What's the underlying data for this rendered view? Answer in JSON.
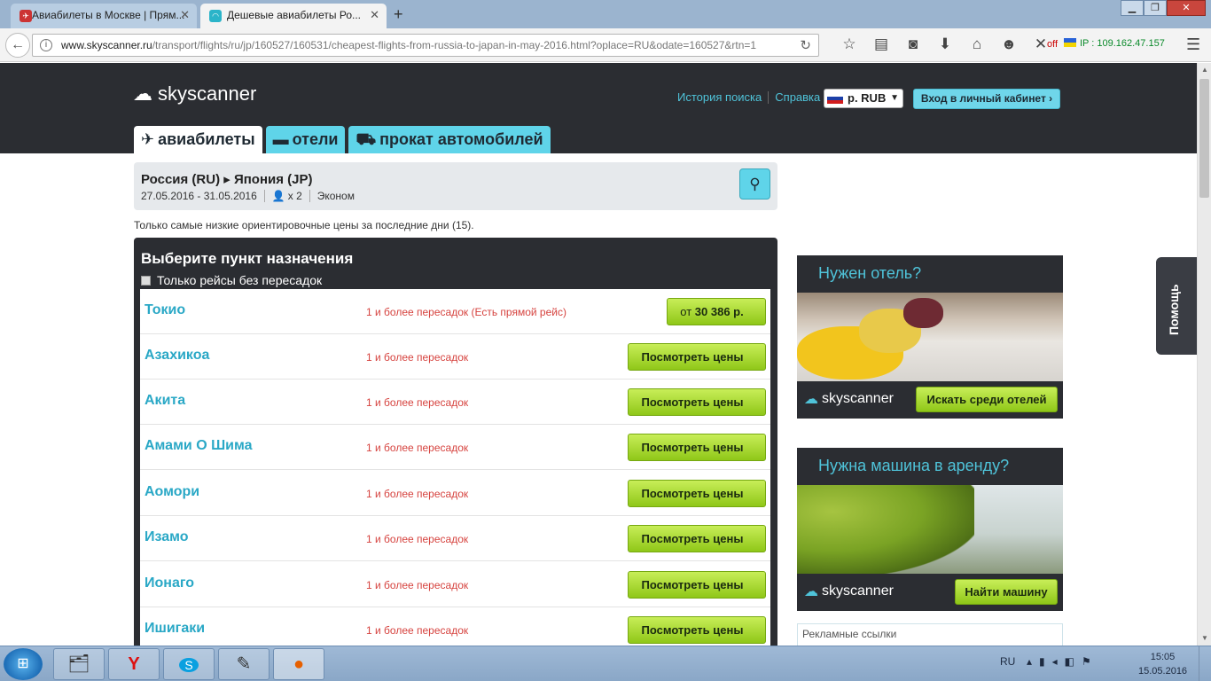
{
  "browser": {
    "tabs": [
      {
        "title": "Авиабилеты в Москве | Прям..."
      },
      {
        "title": "Дешевые авиабилеты Ро..."
      }
    ],
    "new_tab": "+",
    "url_domain": "www.skyscanner.ru",
    "url_path": "/transport/flights/ru/jp/160527/160531/cheapest-flights-from-russia-to-japan-in-may-2016.html?oplace=RU&odate=160527&rtn=1",
    "off_label": "off",
    "ip_label": "IP : 109.162.47.157"
  },
  "header": {
    "logo_text": "skyscanner",
    "history_link": "История поиска",
    "help_link": "Справка",
    "currency": "р. RUB",
    "login_button": "Вход в личный кабинет ›"
  },
  "nav_tabs": [
    {
      "label": "авиабилеты"
    },
    {
      "label": "отели"
    },
    {
      "label": "прокат автомобилей"
    }
  ],
  "search": {
    "route": "Россия (RU) ▸ Япония (JP)",
    "dates": "27.05.2016 - 31.05.2016",
    "passengers": "x 2",
    "cabin": "Эконом"
  },
  "note": "Только самые низкие ориентировочные цены за последние дни (15).",
  "destinations": {
    "title": "Выберите пункт назначения",
    "direct_only_label": "Только рейсы без пересадок",
    "rows": [
      {
        "city": "Токио",
        "stops": "1 и более пересадок (Есть прямой рейс)",
        "price_prefix": "от",
        "price": "30 386 р."
      },
      {
        "city": "Азахикоа",
        "stops": "1 и более пересадок",
        "button": "Посмотреть цены"
      },
      {
        "city": "Акита",
        "stops": "1 и более пересадок",
        "button": "Посмотреть цены"
      },
      {
        "city": "Амами О Шима",
        "stops": "1 и более пересадок",
        "button": "Посмотреть цены"
      },
      {
        "city": "Аомори",
        "stops": "1 и более пересадок",
        "button": "Посмотреть цены"
      },
      {
        "city": "Изамо",
        "stops": "1 и более пересадок",
        "button": "Посмотреть цены"
      },
      {
        "city": "Ионаго",
        "stops": "1 и более пересадок",
        "button": "Посмотреть цены"
      },
      {
        "city": "Ишигаки",
        "stops": "1 и более пересадок",
        "button": "Посмотреть цены"
      }
    ]
  },
  "promos": {
    "hotel": {
      "title": "Нужен отель?",
      "logo": "skyscanner",
      "button": "Искать среди отелей"
    },
    "car": {
      "title": "Нужна машина в аренду?",
      "logo": "skyscanner",
      "button": "Найти машину"
    }
  },
  "ads_label": "Рекламные ссылки",
  "help_tab": "Помощь",
  "taskbar": {
    "lang": "RU",
    "time": "15:05",
    "date": "15.05.2016"
  },
  "colors": {
    "header_bg": "#2b2d32",
    "accent": "#5fd4e9",
    "link": "#2aa8c6",
    "stops_red": "#d6433f",
    "button_green": "#8fc718"
  }
}
